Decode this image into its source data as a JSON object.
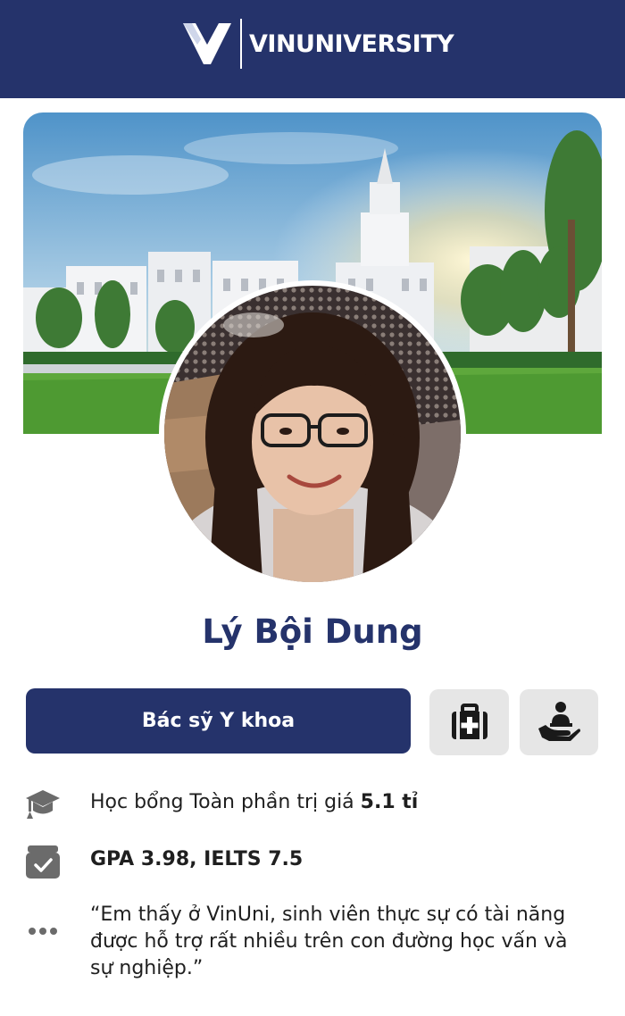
{
  "header": {
    "brand_name": "VINUNIVERSITY",
    "logo_icon": "vinuni-v-logo",
    "background_color": "#25336b"
  },
  "cover": {
    "image": "campus-photo"
  },
  "avatar": {
    "image": "student-portrait"
  },
  "profile": {
    "name": "Lý Bội Dung"
  },
  "actions": {
    "role_label": "Bác sỹ Y khoa",
    "medkit_icon": "medical-kit-icon",
    "care_icon": "hand-care-icon"
  },
  "info": {
    "scholarship": {
      "icon": "graduation-cap-icon",
      "label": "Học bổng Toàn phần trị giá ",
      "value": "5.1 tỉ"
    },
    "scores": {
      "icon": "checked-box-icon",
      "label": "GPA 3.98, IELTS 7.5"
    },
    "quote": {
      "icon": "ellipsis-icon",
      "text": "“Em thấy ở VinUni, sinh viên thực sự có tài năng được hỗ trợ rất nhiều trên con đường học vấn và sự nghiệp.”"
    }
  },
  "colors": {
    "brand_navy": "#25336b",
    "icon_button_bg": "#e6e6e6",
    "text": "#1f1f1f"
  }
}
